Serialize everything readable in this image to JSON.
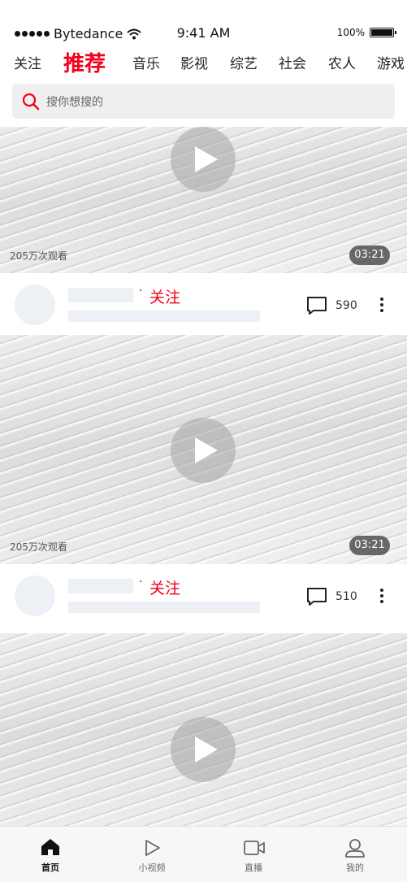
{
  "status_bar": {
    "carrier": "Bytedance",
    "time": "9:41 AM",
    "battery": "100%"
  },
  "tabs": [
    {
      "label": "关注",
      "active": false
    },
    {
      "label": "推荐",
      "active": true
    },
    {
      "label": "音乐",
      "active": false
    },
    {
      "label": "影视",
      "active": false
    },
    {
      "label": "综艺",
      "active": false
    },
    {
      "label": "社会",
      "active": false
    },
    {
      "label": "农人",
      "active": false
    },
    {
      "label": "游戏",
      "active": false
    }
  ],
  "search": {
    "placeholder": "搜你想搜的"
  },
  "feed": [
    {
      "views": "205万次观看",
      "duration": "03:21",
      "follow_label": "关注",
      "comment_count": "590"
    },
    {
      "views": "205万次观看",
      "duration": "03:21",
      "follow_label": "关注",
      "comment_count": "510"
    }
  ],
  "nav": [
    {
      "label": "首页",
      "icon": "home-icon",
      "active": true
    },
    {
      "label": "小视频",
      "icon": "play-icon",
      "active": false
    },
    {
      "label": "直播",
      "icon": "camera-icon",
      "active": false
    },
    {
      "label": "我的",
      "icon": "user-icon",
      "active": false
    }
  ],
  "colors": {
    "accent": "#f2001c",
    "placeholder": "#edf0f5",
    "nav_bg": "#f7f7f7"
  }
}
